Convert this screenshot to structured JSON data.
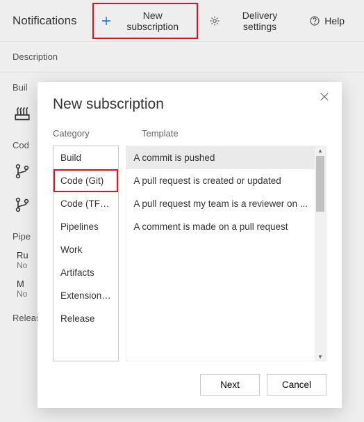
{
  "topbar": {
    "title": "Notifications",
    "new_subscription": "New subscription",
    "delivery_settings": "Delivery settings",
    "help": "Help"
  },
  "subheader": "Description",
  "background": {
    "sections": [
      {
        "label": "Buil"
      },
      {
        "label": "Cod"
      },
      {
        "label": "Pipe"
      },
      {
        "label": "Release"
      }
    ],
    "rows": [
      {
        "title": "Ru",
        "sub": "No"
      },
      {
        "title": "M",
        "sub": "No"
      }
    ]
  },
  "modal": {
    "title": "New subscription",
    "category_label": "Category",
    "template_label": "Template",
    "categories": [
      "Build",
      "Code (Git)",
      "Code (TFVC)",
      "Pipelines",
      "Work",
      "Artifacts",
      "Extension ...",
      "Release"
    ],
    "selected_category_index": 1,
    "templates": [
      "A commit is pushed",
      "A pull request is created or updated",
      "A pull request my team is a reviewer on ...",
      "A comment is made on a pull request"
    ],
    "selected_template_index": 0,
    "next": "Next",
    "cancel": "Cancel"
  }
}
